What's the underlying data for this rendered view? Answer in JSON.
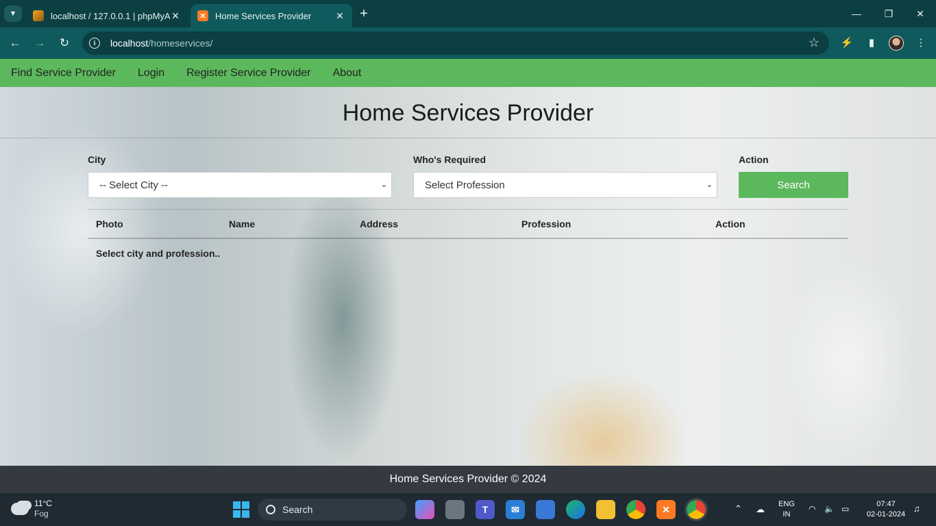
{
  "browser": {
    "tabs": [
      {
        "title": "localhost / 127.0.0.1 | phpMyAd",
        "active": false
      },
      {
        "title": "Home Services Provider",
        "active": true
      }
    ],
    "url_host": "localhost",
    "url_path": "/homeservices/"
  },
  "nav": {
    "items": [
      "Find Service Provider",
      "Login",
      "Register Service Provider",
      "About"
    ]
  },
  "page": {
    "title": "Home Services Provider",
    "form": {
      "city_label": "City",
      "city_selected": "-- Select City --",
      "profession_label": "Who's Required",
      "profession_selected": "Select Profession",
      "action_label": "Action",
      "search_label": "Search"
    },
    "table": {
      "headers": [
        "Photo",
        "Name",
        "Address",
        "Profession",
        "Action"
      ],
      "empty_message": "Select city and profession.."
    },
    "footer": "Home Services Provider © 2024"
  },
  "taskbar": {
    "weather_temp": "11°C",
    "weather_condition": "Fog",
    "search_placeholder": "Search",
    "language": "ENG",
    "region": "IN",
    "time": "07:47",
    "date": "02-01-2024"
  },
  "colors": {
    "nav_green": "#5cb85c",
    "footer_dark": "#343a40",
    "browser_teal": "#0f5a5d"
  }
}
